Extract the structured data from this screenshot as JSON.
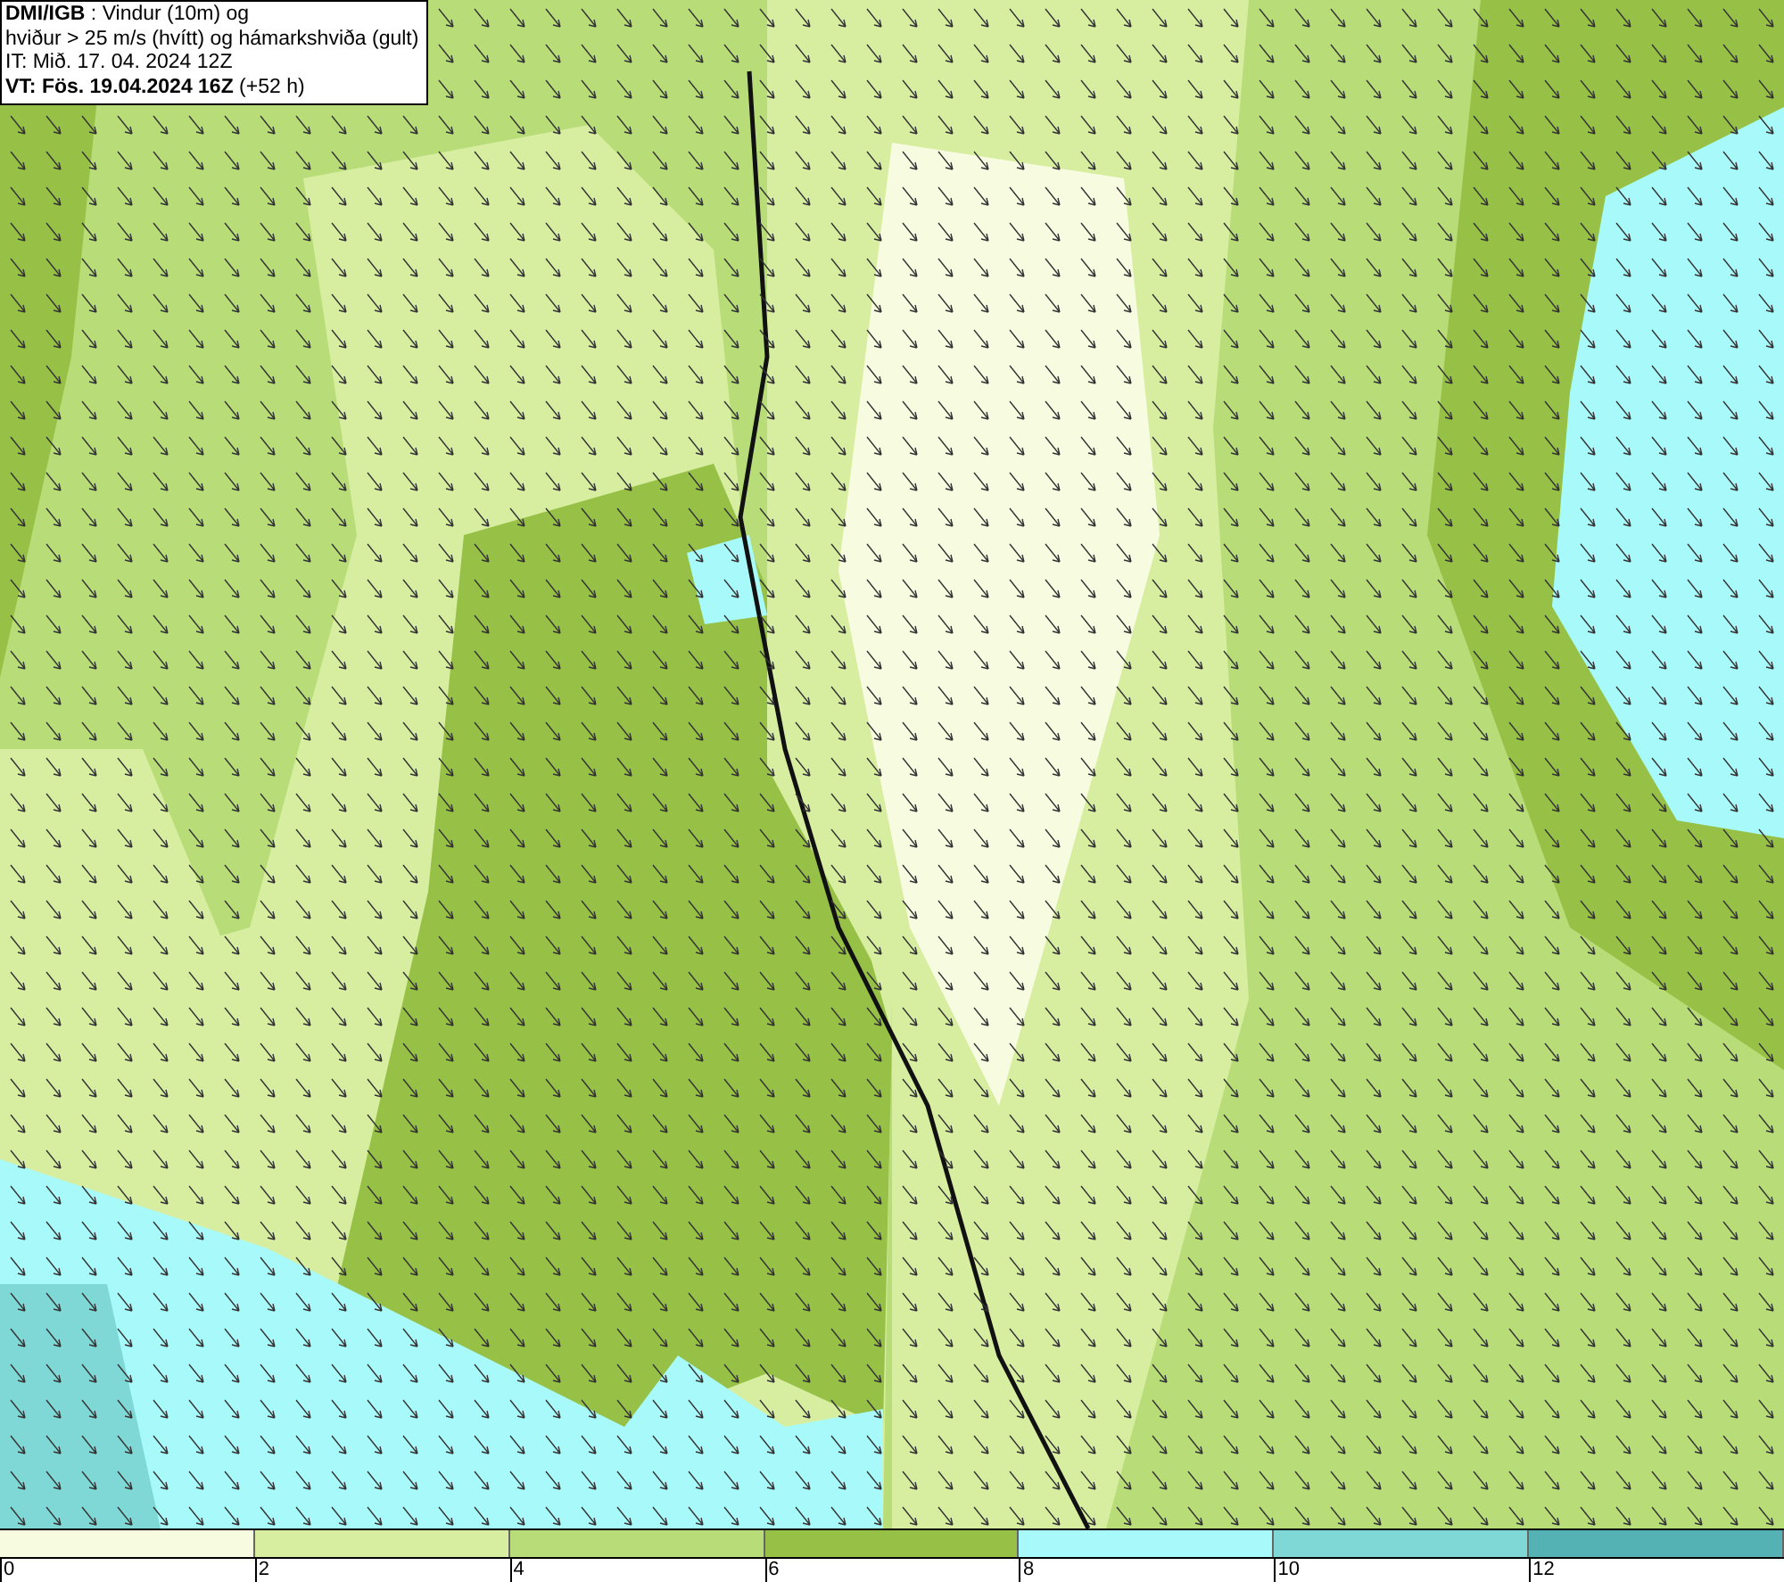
{
  "info_box": {
    "lines": [
      "**DMI/IGB** : Vindur (10m) og",
      "hviður > 25 m/s (hvítt) og hámarkshviða (gult)",
      "IT: Mið. 17. 04. 2024 12Z",
      "**VT: Fös. 19.04.2024 16Z** (+52 h)"
    ]
  },
  "legend": {
    "segments": [
      {
        "label": "0",
        "color": "#f7fbe0"
      },
      {
        "label": "2",
        "color": "#d7eea0"
      },
      {
        "label": "4",
        "color": "#b8dc78"
      },
      {
        "label": "6",
        "color": "#96c046"
      },
      {
        "label": "8",
        "color": "#a8fafa"
      },
      {
        "label": "10",
        "color": "#7fd8d6"
      },
      {
        "label": "12",
        "color": "#55b2b4"
      }
    ]
  }
}
